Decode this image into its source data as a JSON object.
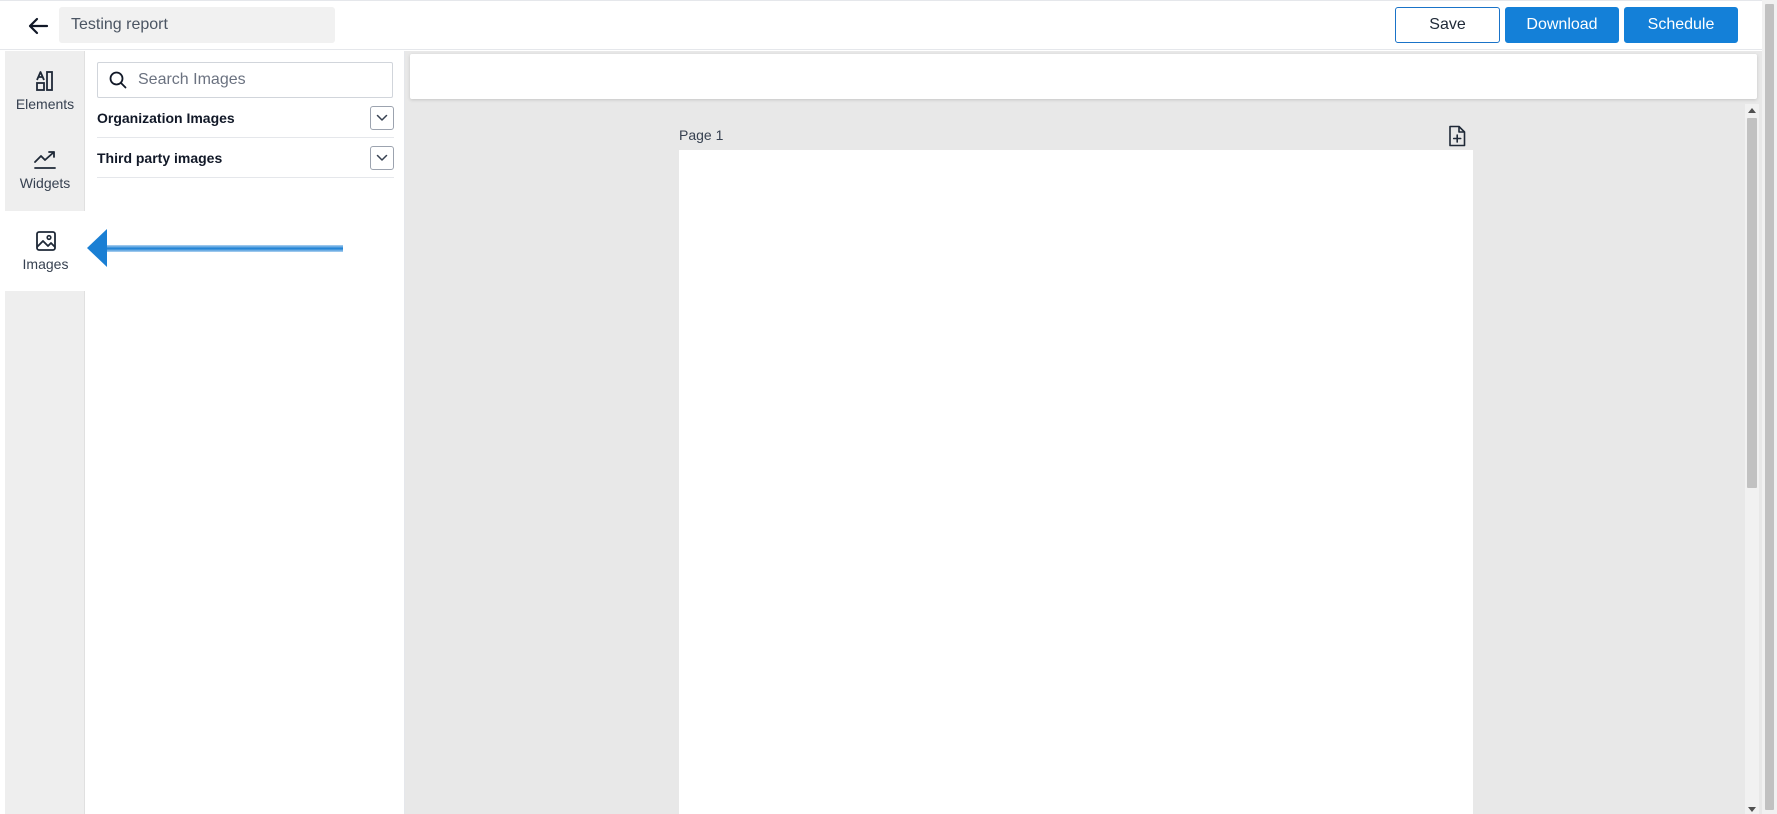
{
  "header": {
    "title_value": "Testing report",
    "save_label": "Save",
    "download_label": "Download",
    "schedule_label": "Schedule",
    "back_icon": "arrow-left-icon",
    "accent_color": "#1480d8"
  },
  "sidebar": {
    "items": [
      {
        "label": "Elements",
        "icon": "elements-icon",
        "active": false
      },
      {
        "label": "Widgets",
        "icon": "chart-line-icon",
        "active": false
      },
      {
        "label": "Images",
        "icon": "image-icon",
        "active": true
      }
    ]
  },
  "images_panel": {
    "search_placeholder": "Search Images",
    "sections": [
      {
        "title": "Organization Images",
        "expanded": false
      },
      {
        "title": "Third party images",
        "expanded": false
      }
    ]
  },
  "canvas": {
    "page_label": "Page 1",
    "add_page_icon": "add-page-icon"
  },
  "annotation": {
    "arrow_color": "#1a7fd4",
    "points_to": "Images"
  }
}
